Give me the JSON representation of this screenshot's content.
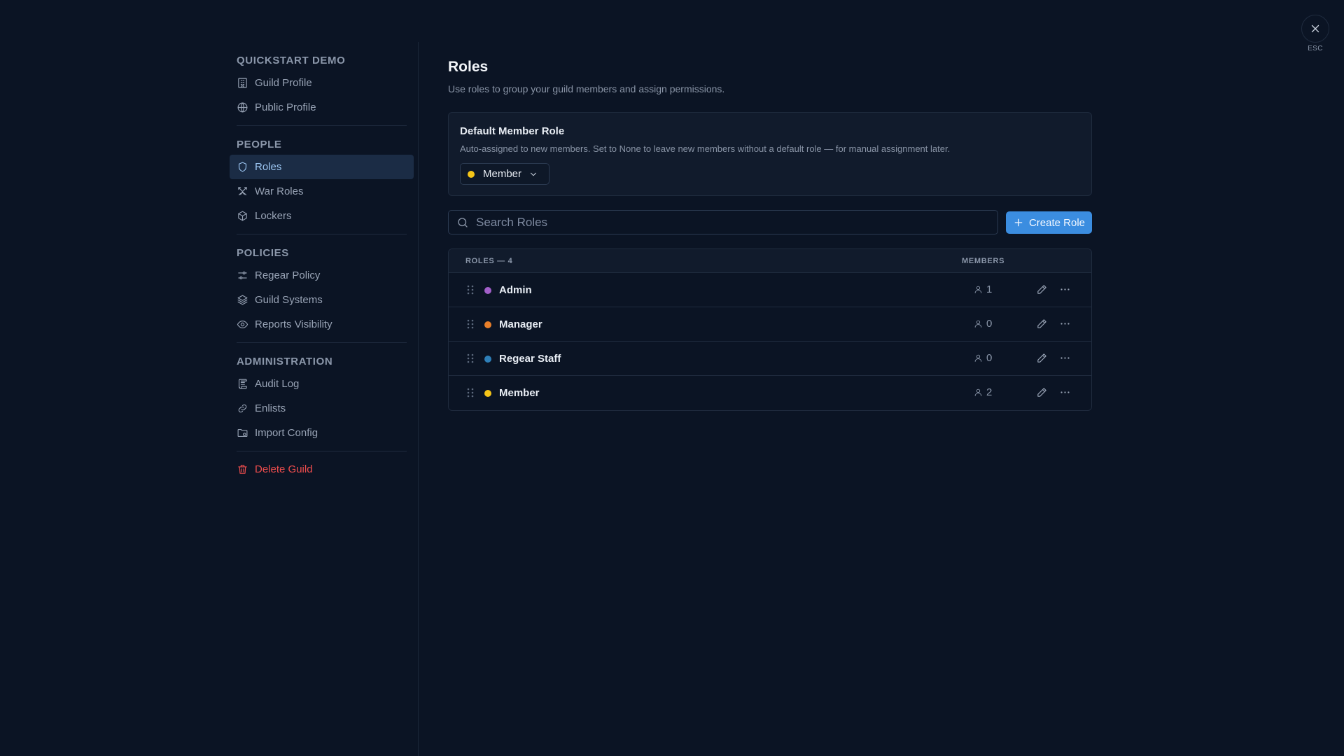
{
  "sidebar": {
    "sections": [
      {
        "title": "QUICKSTART DEMO",
        "items": [
          {
            "label": "Guild Profile",
            "icon": "building-icon"
          },
          {
            "label": "Public Profile",
            "icon": "globe-icon"
          }
        ]
      },
      {
        "title": "PEOPLE",
        "items": [
          {
            "label": "Roles",
            "icon": "shield-icon",
            "active": true
          },
          {
            "label": "War Roles",
            "icon": "swords-icon"
          },
          {
            "label": "Lockers",
            "icon": "box-icon"
          }
        ]
      },
      {
        "title": "POLICIES",
        "items": [
          {
            "label": "Regear Policy",
            "icon": "sliders-icon"
          },
          {
            "label": "Guild Systems",
            "icon": "layers-icon"
          },
          {
            "label": "Reports Visibility",
            "icon": "eye-icon"
          }
        ]
      },
      {
        "title": "ADMINISTRATION",
        "items": [
          {
            "label": "Audit Log",
            "icon": "scroll-icon"
          },
          {
            "label": "Enlists",
            "icon": "link-icon"
          },
          {
            "label": "Import Config",
            "icon": "folder-icon"
          }
        ]
      }
    ],
    "delete_label": "Delete Guild"
  },
  "main": {
    "title": "Roles",
    "subtitle": "Use roles to group your guild members and assign permissions.",
    "default_role": {
      "title": "Default Member Role",
      "description": "Auto-assigned to new members. Set to None to leave new members without a default role — for manual assignment later.",
      "selected": "Member",
      "selected_color": "#f5c518"
    },
    "search": {
      "placeholder": "Search Roles",
      "value": ""
    },
    "create_label": "Create Role",
    "table": {
      "roles_header": "ROLES — 4",
      "members_header": "MEMBERS",
      "rows": [
        {
          "name": "Admin",
          "color": "#a25fc9",
          "members": "1"
        },
        {
          "name": "Manager",
          "color": "#e97f2a",
          "members": "0"
        },
        {
          "name": "Regear Staff",
          "color": "#2e7fb8",
          "members": "0"
        },
        {
          "name": "Member",
          "color": "#f5c518",
          "members": "2"
        }
      ]
    }
  },
  "close": {
    "esc_label": "ESC"
  },
  "colors": {
    "accent": "#3b8de0",
    "danger": "#ef4d4d",
    "active_bg": "#1b2c45"
  }
}
